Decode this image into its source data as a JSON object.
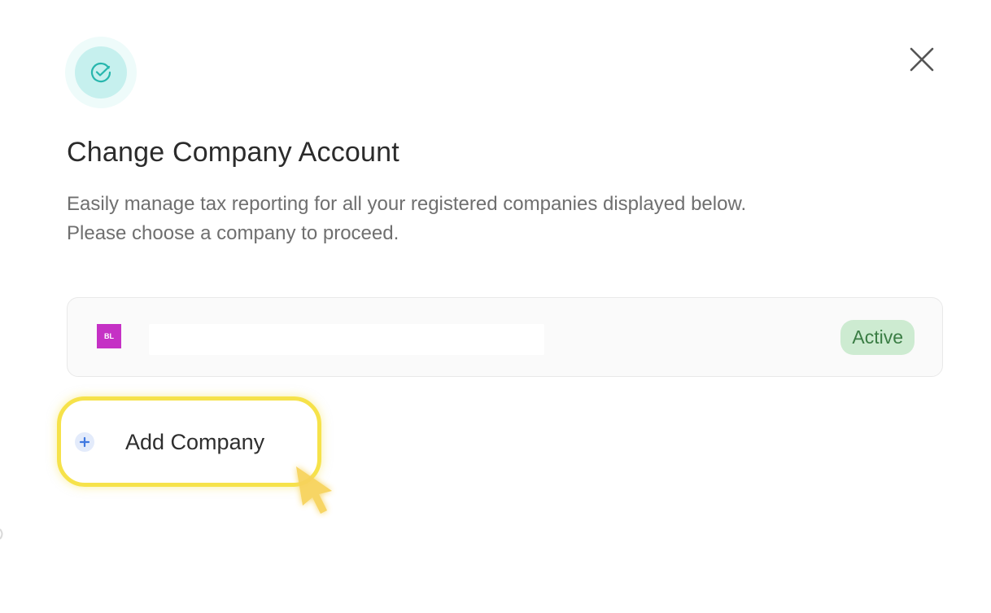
{
  "modal": {
    "header_icon": "check-circle-icon",
    "close_icon": "close-icon",
    "title": "Change Company Account",
    "description_line1": "Easily manage tax reporting for all your registered companies displayed below.",
    "description_line2": "Please choose a company to proceed."
  },
  "companies": [
    {
      "initials": "BL",
      "name": "",
      "status": "Active",
      "avatar_color": "#c531c5",
      "status_color": "#3a7d44",
      "status_bg": "#cdebd1"
    }
  ],
  "add_company": {
    "label": "Add Company",
    "icon": "plus-circle-icon"
  },
  "colors": {
    "accent_teal": "#27b6ad",
    "highlight_yellow": "#f6e24a",
    "add_icon_blue": "#3f78e0"
  }
}
